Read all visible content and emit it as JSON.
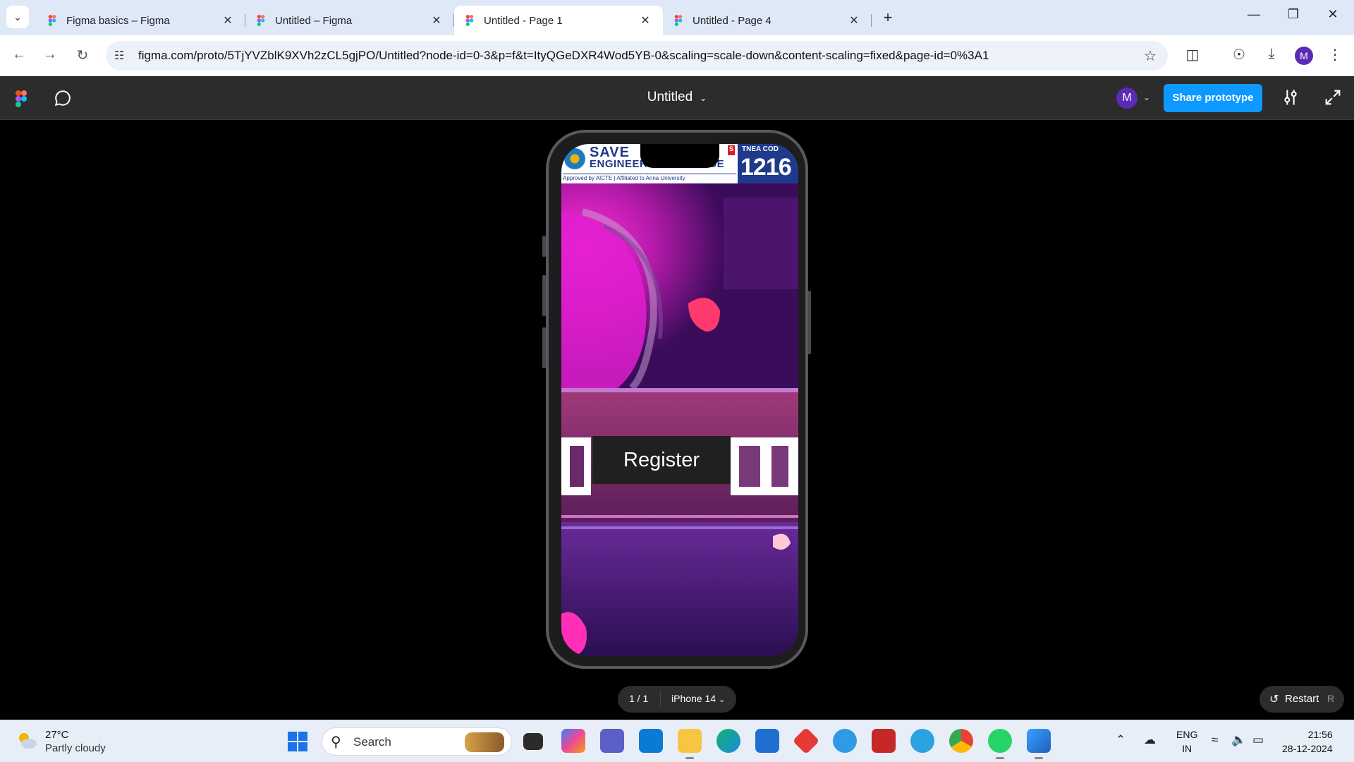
{
  "browser": {
    "tabs": [
      {
        "title": "Figma basics – Figma",
        "active": false
      },
      {
        "title": "Untitled – Figma",
        "active": false
      },
      {
        "title": "Untitled - Page 1",
        "active": true
      },
      {
        "title": "Untitled - Page 4",
        "active": false
      }
    ],
    "url": "figma.com/proto/5TjYVZblK9XVh2zCL5gjPO/Untitled?node-id=0-3&p=f&t=ItyQGeDXR4Wod5YB-0&scaling=scale-down&content-scaling=fixed&page-id=0%3A1",
    "profile_initial": "M"
  },
  "figma": {
    "file_title": "Untitled",
    "user_initial": "M",
    "share_label": "Share prototype"
  },
  "prototype": {
    "banner": {
      "name_line1": "SAVE",
      "name_line2": "ENGINEERING COLLEGE",
      "approved": "Approved by AICTE | Affiliated to Anna University",
      "badge": "S",
      "tnea_label": "TNEA COD",
      "tnea_code": "1216"
    },
    "register_label": "Register"
  },
  "controls": {
    "page_count": "1 / 1",
    "device": "iPhone 14",
    "restart_label": "Restart",
    "restart_key": "R"
  },
  "taskbar": {
    "temperature": "27°C",
    "weather": "Partly cloudy",
    "search_label": "Search",
    "lang_line1": "ENG",
    "lang_line2": "IN",
    "time": "21:56",
    "date": "28-12-2024"
  },
  "colors": {
    "figma_blue": "#0d99ff",
    "figma_dark": "#2c2c2c",
    "avatar_purple": "#5b2bb5",
    "college_blue": "#1f3a8c"
  }
}
